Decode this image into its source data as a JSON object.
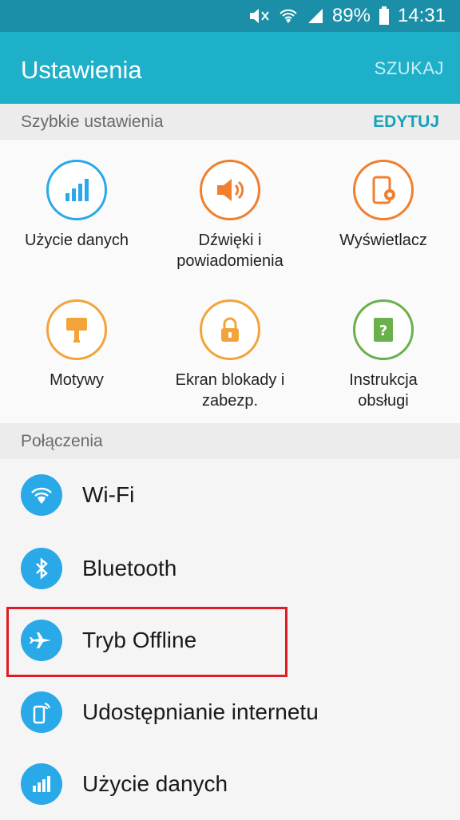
{
  "status_bar": {
    "battery": "89%",
    "time": "14:31"
  },
  "app_bar": {
    "title": "Ustawienia",
    "search_label": "SZUKAJ"
  },
  "quick_settings": {
    "header": "Szybkie ustawienia",
    "edit_label": "EDYTUJ",
    "items": [
      {
        "label": "Użycie danych",
        "icon": "data-usage-icon",
        "color": "#2aa9e8"
      },
      {
        "label": "Dźwięki i powiadomienia",
        "icon": "sound-icon",
        "color": "#f07f2f"
      },
      {
        "label": "Wyświetlacz",
        "icon": "display-icon",
        "color": "#f07f2f"
      },
      {
        "label": "Motywy",
        "icon": "themes-icon",
        "color": "#f2a43b"
      },
      {
        "label": "Ekran blokady i zabezp.",
        "icon": "lock-icon",
        "color": "#f2a43b"
      },
      {
        "label": "Instrukcja obsługi",
        "icon": "help-icon",
        "color": "#6ab04c"
      }
    ]
  },
  "connections": {
    "header": "Połączenia",
    "items": [
      {
        "label": "Wi-Fi",
        "icon": "wifi-icon"
      },
      {
        "label": "Bluetooth",
        "icon": "bluetooth-icon"
      },
      {
        "label": "Tryb Offline",
        "icon": "airplane-icon"
      },
      {
        "label": "Udostępnianie internetu",
        "icon": "hotspot-icon"
      },
      {
        "label": "Użycie danych",
        "icon": "data-usage-icon"
      }
    ]
  },
  "colors": {
    "accent": "#1fb0c9",
    "status_bar": "#1a8fa7",
    "list_icon": "#2aa9e8",
    "highlight": "#e01b24"
  }
}
